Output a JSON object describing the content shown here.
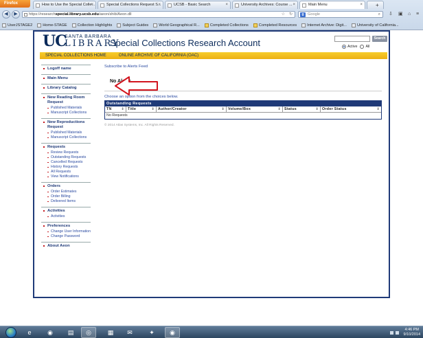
{
  "browser": {
    "menu_button": "Firefox",
    "tabs": [
      {
        "label": "How to Use the Special Colle..."
      },
      {
        "label": "Special Collections Request S..."
      },
      {
        "label": "UCSB - Basic Search"
      },
      {
        "label": "University Archives: Course ..."
      },
      {
        "label": "Main Menu",
        "active": true
      }
    ],
    "new_tab": "+",
    "url_prefix": "https://research",
    "url_domain": "special.library.ucsb.edu",
    "url_path": "/aeon/shib/Aeon.dll",
    "search_engine_icon": "google-g-icon",
    "search_placeholder": "Google",
    "bookmarks": [
      {
        "label": "UserJSTAGE2",
        "icon": "page"
      },
      {
        "label": "Home-STAGE",
        "icon": "page"
      },
      {
        "label": "Collection Highlights",
        "icon": "page"
      },
      {
        "label": "Subject Guides",
        "icon": "page"
      },
      {
        "label": "World Geographical R...",
        "icon": "page"
      },
      {
        "label": "Completed Collections",
        "icon": "folder"
      },
      {
        "label": "Completed Resources",
        "icon": "folder"
      },
      {
        "label": "Internet Archive: Digit...",
        "icon": "page"
      },
      {
        "label": "University of California...",
        "icon": "page"
      }
    ]
  },
  "header": {
    "logo_uc": "UC",
    "logo_sb": "SANTA BARBARA",
    "logo_library": "LIBRARY",
    "title": "Special Collections Research Account",
    "search_button": "Search",
    "scope_options": [
      {
        "label": "Active",
        "selected": true
      },
      {
        "label": "All",
        "selected": false
      }
    ],
    "nav_links": [
      "SPECIAL COLLECTIONS HOME",
      "ONLINE ARCHIVE OF CALIFORNIA (OAC)"
    ]
  },
  "sidebar": {
    "sections": [
      {
        "title": "Logoff name",
        "items": []
      },
      {
        "title": "Main Menu",
        "items": []
      },
      {
        "title": "Library Catalog",
        "items": []
      },
      {
        "title": "New Reading Room Request",
        "items": [
          "Published Materials",
          "Manuscript Collections"
        ]
      },
      {
        "title": "New Reproductions Request",
        "items": [
          "Published Materials",
          "Manuscript Collections"
        ]
      },
      {
        "title": "Requests",
        "items": [
          "Review Requests",
          "Outstanding Requests",
          "Cancelled Requests",
          "History Requests",
          "All Requests",
          "View Notifications"
        ]
      },
      {
        "title": "Orders",
        "items": [
          "Order Estimates",
          "Order Billing",
          "Delivered Items"
        ]
      },
      {
        "title": "Activities",
        "items": [
          "Activities"
        ]
      },
      {
        "title": "Preferences",
        "items": [
          "Change User Information",
          "Change Password"
        ]
      },
      {
        "title": "About Aeon",
        "items": []
      }
    ]
  },
  "content": {
    "rss_link": "Subscribe to Alerts Feed",
    "alerts_text": "No Alerts",
    "choose_text": "Choose an option from the choices below.",
    "table": {
      "caption": "Outstanding Requests",
      "columns": [
        "TN",
        "Title",
        "Author/Creator",
        "Volume/Box",
        "Status",
        "Order Status"
      ],
      "empty_text": "No Requests"
    },
    "copyright": "© 2014 Atlas Systems, Inc. All Rights Reserved."
  },
  "taskbar": {
    "apps": [
      {
        "icon": "internet-explorer-icon"
      },
      {
        "icon": "firefox-icon"
      },
      {
        "icon": "file-explorer-icon"
      },
      {
        "icon": "chrome-icon",
        "active": true
      },
      {
        "icon": "calculator-icon"
      },
      {
        "icon": "outlook-icon"
      },
      {
        "icon": "settings-icon"
      },
      {
        "icon": "firefox-icon",
        "active": true
      }
    ],
    "clock_time": "4:46 PM",
    "clock_date": "9/10/2014"
  },
  "colors": {
    "ucsb_navy": "#0a2a5a",
    "ucsb_gold": "#f2c21b",
    "annotation_red": "#d2141e"
  }
}
